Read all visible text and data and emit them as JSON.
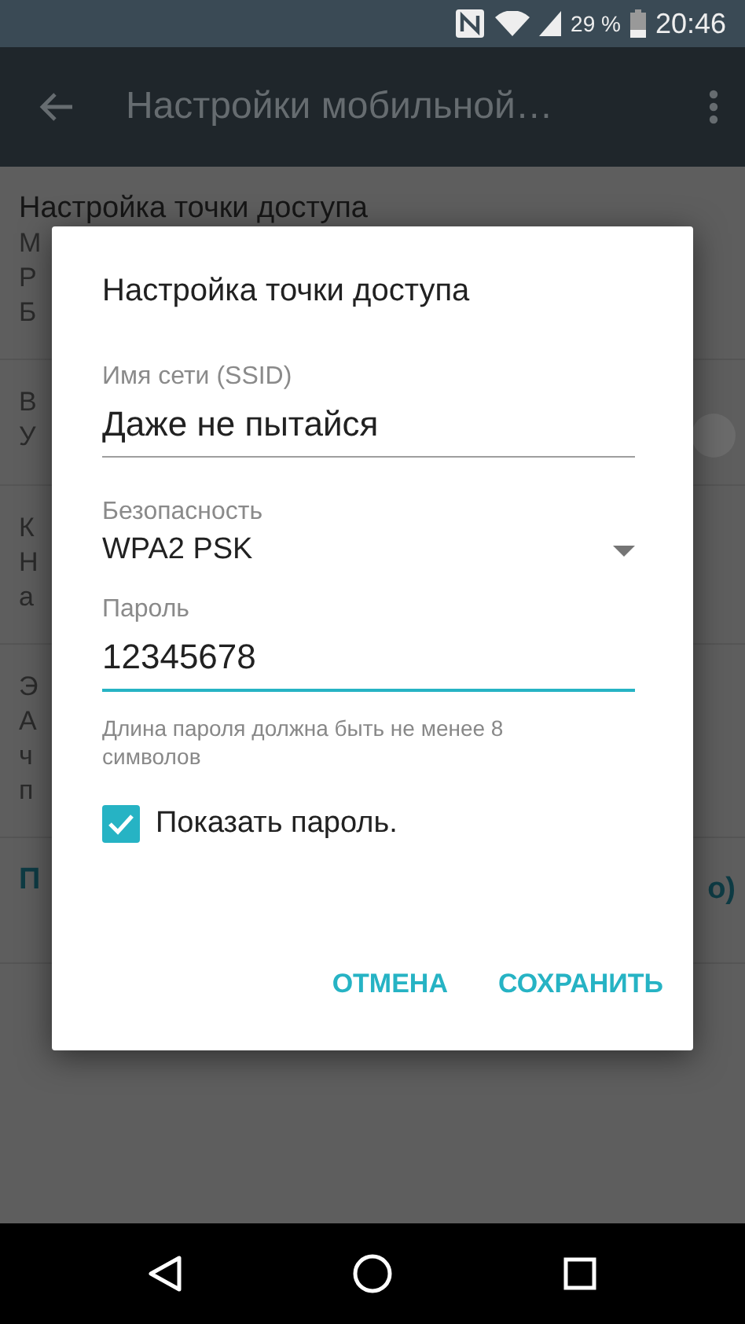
{
  "status_bar": {
    "battery": "29 %",
    "time": "20:46"
  },
  "toolbar": {
    "title": "Настройки мобильной…"
  },
  "background_rows": [
    {
      "kind": "text",
      "title": "Настройка точки доступа",
      "lines": [
        "М",
        "Р",
        "Б"
      ]
    },
    {
      "kind": "toggle",
      "lines": [
        "В",
        "У"
      ],
      "on": false
    },
    {
      "kind": "text",
      "lines": [
        "К",
        "Н",
        "а"
      ]
    },
    {
      "kind": "text",
      "lines": [
        "Э",
        "А",
        "ч",
        "п"
      ]
    },
    {
      "kind": "link",
      "lines": [
        "П"
      ],
      "trailing": "о)"
    }
  ],
  "dialog": {
    "title": "Настройка точки доступа",
    "fields": [
      {
        "kind": "text",
        "label": "Имя сети (SSID)",
        "value": "Даже не пытайся",
        "focused": false
      },
      {
        "kind": "select",
        "label": "Безопасность",
        "value": "WPA2 PSK"
      },
      {
        "kind": "text",
        "label": "Пароль",
        "value": "12345678",
        "focused": true,
        "hint": "Длина пароля должна быть не менее 8 символов"
      }
    ],
    "checkbox": {
      "label": "Показать пароль.",
      "checked": true
    },
    "buttons": [
      "ОТМЕНА",
      "СОХРАНИТЬ"
    ]
  }
}
